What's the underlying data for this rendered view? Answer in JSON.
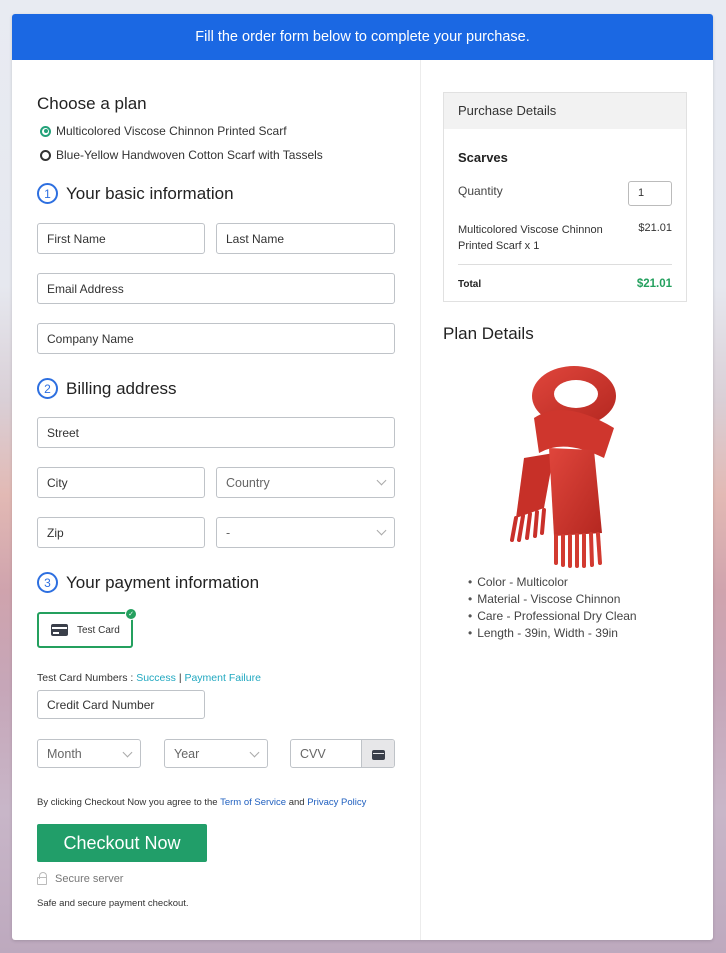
{
  "banner": {
    "text": "Fill the order form below to complete your purchase."
  },
  "plan": {
    "heading": "Choose a plan",
    "options": [
      {
        "label": "Multicolored Viscose Chinnon Printed Scarf",
        "selected": true
      },
      {
        "label": "Blue-Yellow Handwoven Cotton Scarf with Tassels",
        "selected": false
      }
    ]
  },
  "basic": {
    "number": "1",
    "heading": "Your basic information",
    "first_name": "First Name",
    "last_name": "Last Name",
    "email": "Email Address",
    "company": "Company Name"
  },
  "billing": {
    "number": "2",
    "heading": "Billing address",
    "street": "Street",
    "city": "City",
    "country": "Country",
    "zip": "Zip",
    "state": "-"
  },
  "payment": {
    "number": "3",
    "heading": "Your payment information",
    "method_label": "Test Card",
    "test_numbers_label": "Test Card Numbers :",
    "success_link": "Success",
    "separator": "|",
    "failure_link": "Payment Failure",
    "card_number": "Credit Card Number",
    "month": "Month",
    "year": "Year",
    "cvv": "CVV"
  },
  "terms": {
    "prefix": "By clicking Checkout Now you agree to the",
    "tos": "Term of Service",
    "and": "and",
    "privacy": "Privacy Policy"
  },
  "checkout": {
    "button": "Checkout Now",
    "secure": "Secure server",
    "safe": "Safe and secure payment checkout."
  },
  "purchase": {
    "heading": "Purchase Details",
    "category": "Scarves",
    "quantity_label": "Quantity",
    "quantity": "1",
    "item": "Multicolored Viscose Chinnon Printed Scarf x 1",
    "price": "$21.01",
    "total_label": "Total",
    "total": "$21.01",
    "total_color": "#24a05e"
  },
  "plan_details": {
    "heading": "Plan Details",
    "image": "red-scarf",
    "features": [
      "Color - Multicolor",
      "Material - Viscose Chinnon",
      "Care - Professional Dry Clean",
      "Length - 39in, Width - 39in"
    ]
  },
  "colors": {
    "banner": "#1b68e3",
    "accent_green": "#219e69",
    "step_blue": "#2d6fe0"
  }
}
